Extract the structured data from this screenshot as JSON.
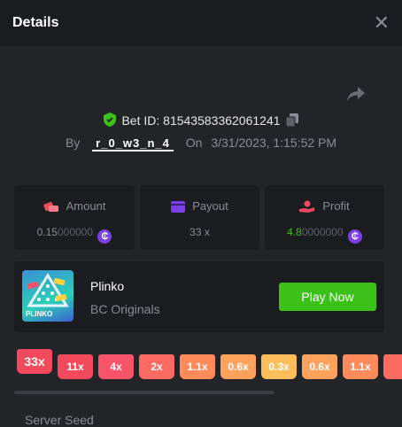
{
  "header": {
    "title": "Details",
    "close_label": "✕"
  },
  "bet": {
    "id_label": "Bet ID: 81543583362061241",
    "by_label": "By",
    "username": "r_0_w3_n_4",
    "on_label": "On",
    "timestamp": "3/31/2023, 1:15:52 PM"
  },
  "stats": {
    "amount": {
      "label": "Amount",
      "value_main": "0.15",
      "value_dim": "000000"
    },
    "payout": {
      "label": "Payout",
      "value": "33 x"
    },
    "profit": {
      "label": "Profit",
      "value_main": "4.8",
      "value_dim": "0000000"
    }
  },
  "game": {
    "name": "Plinko",
    "provider": "BC Originals",
    "thumb_text": "PLINKO",
    "play_label": "Play Now"
  },
  "multipliers": {
    "selected": "33x",
    "items": [
      "11x",
      "4x",
      "2x",
      "1.1x",
      "0.6x",
      "0.3x",
      "0.6x",
      "1.1x",
      ""
    ]
  },
  "section": {
    "server_seed_label": "Server Seed"
  },
  "colors": {
    "accent_green": "#3bc117",
    "coin_purple": "#7b3fe4",
    "mult_red": "#f2495c",
    "mult_orange": "#ff7b5c",
    "mult_yellow": "#ffbe5c"
  }
}
